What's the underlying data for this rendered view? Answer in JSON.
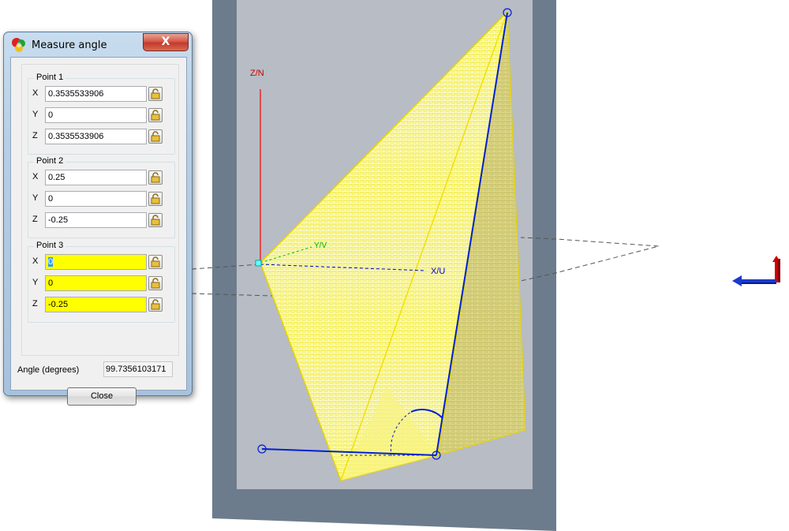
{
  "dialog": {
    "title": "Measure angle",
    "close_x": "X",
    "point1": {
      "title": "Point 1",
      "x_label": "X",
      "y_label": "Y",
      "z_label": "Z",
      "x": "0.3535533906",
      "y": "0",
      "z": "0.3535533906"
    },
    "point2": {
      "title": "Point 2",
      "x_label": "X",
      "y_label": "Y",
      "z_label": "Z",
      "x": "0.25",
      "y": "0",
      "z": "-0.25"
    },
    "point3": {
      "title": "Point 3",
      "x_label": "X",
      "y_label": "Y",
      "z_label": "Z",
      "x": "0",
      "y": "0",
      "z": "-0.25"
    },
    "angle_label": "Angle (degrees)",
    "angle_value": "99.7356103171",
    "close_label": "Close"
  },
  "viewport": {
    "axis_z_label": "Z/N",
    "axis_x_label": "X/U",
    "axis_y_label": "Y/V",
    "colors": {
      "z_axis": "#ff0000",
      "x_axis": "#0000cc",
      "y_axis": "#00c000",
      "surface": "#ffff33",
      "measure": "#0020d0",
      "view_bg": "#b8bcc4",
      "frame": "#6c7c8c"
    }
  },
  "icons": {
    "app": "app-logo-icon",
    "lock": "padlock-icon",
    "gizmo": "orientation-gizmo-icon"
  }
}
